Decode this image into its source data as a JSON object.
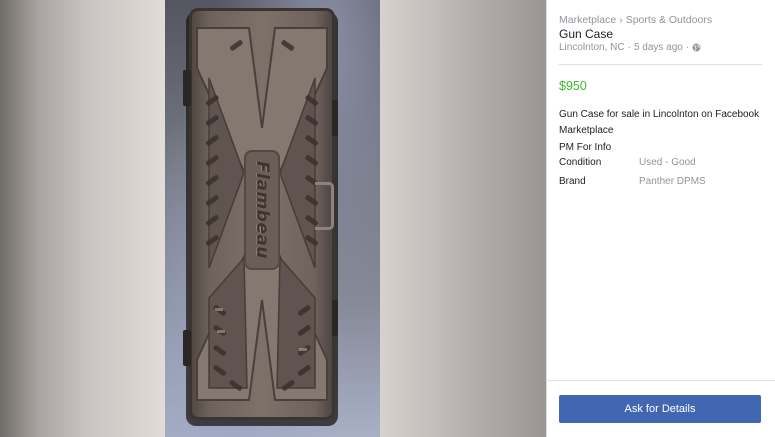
{
  "photo": {
    "brand_mark": "Flambeau"
  },
  "listing": {
    "breadcrumb": [
      "Marketplace",
      "Sports & Outdoors"
    ],
    "breadcrumb_separator": "›",
    "title": "Gun Case",
    "location": "Lincolnton, NC",
    "posted": "5 days ago",
    "meta_separator": "·",
    "price": "$950",
    "description": "Gun Case for sale in Lincolnton on Facebook Marketplace",
    "note": "PM For Info",
    "details": [
      {
        "label": "Condition",
        "value": "Used - Good"
      },
      {
        "label": "Brand",
        "value": "Panther DPMS"
      }
    ]
  },
  "actions": {
    "ask_label": "Ask for Details"
  },
  "colors": {
    "price": "#42b72a",
    "button": "#4267b2",
    "muted_text": "#90949c"
  },
  "icons": {
    "visibility": "globe-icon"
  }
}
